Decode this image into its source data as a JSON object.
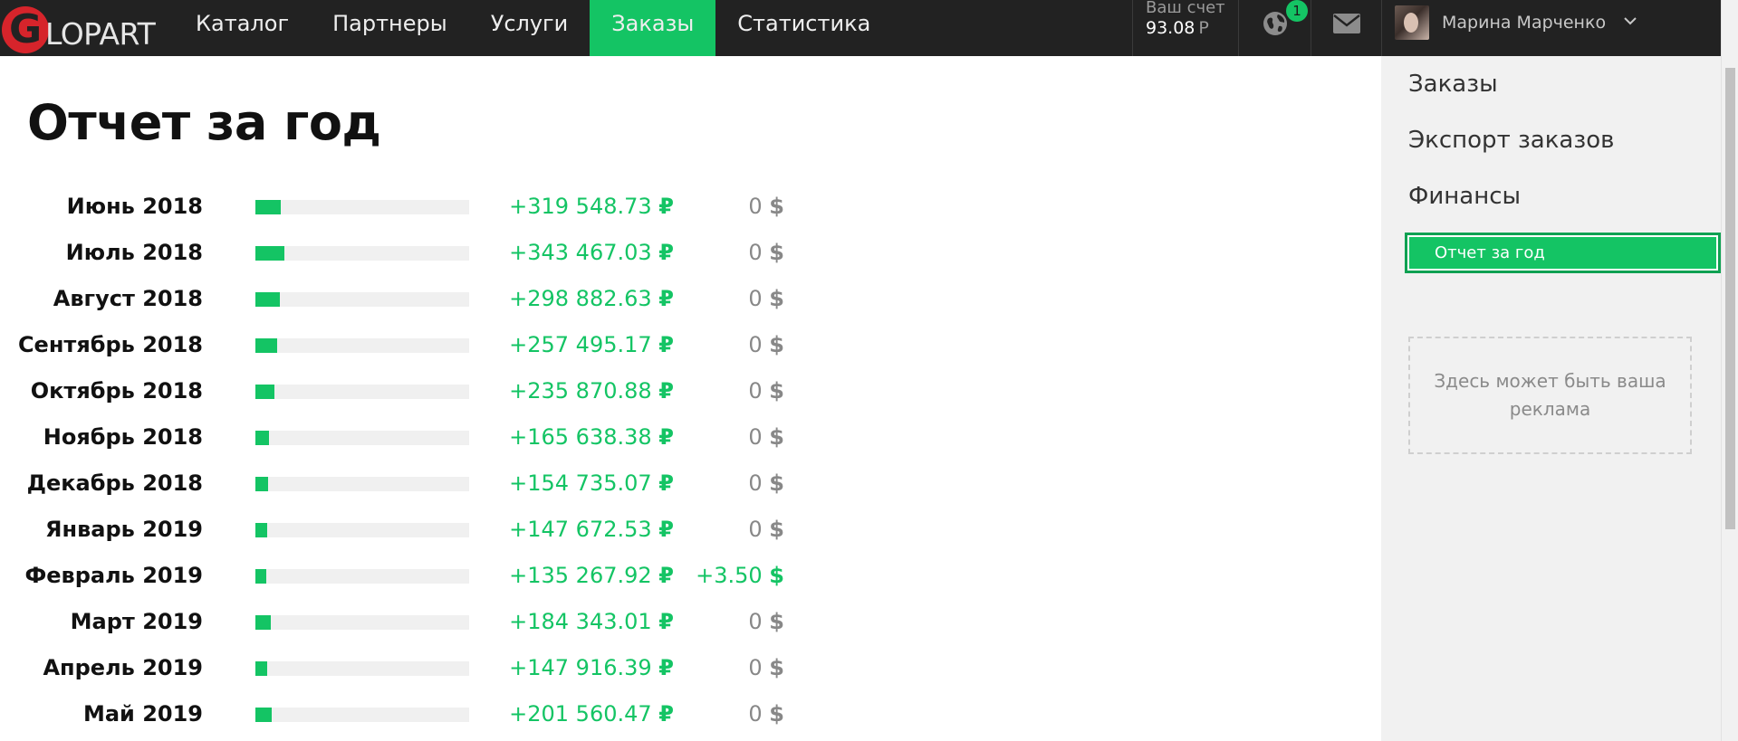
{
  "brand": {
    "logo_letter": "G",
    "logo_text": "LOPART"
  },
  "nav": {
    "items": [
      {
        "label": "Каталог",
        "active": false
      },
      {
        "label": "Партнеры",
        "active": false
      },
      {
        "label": "Услуги",
        "active": false
      },
      {
        "label": "Заказы",
        "active": true
      },
      {
        "label": "Статистика",
        "active": false
      }
    ]
  },
  "account": {
    "label": "Ваш счет",
    "value": "93.08",
    "currency": "Р"
  },
  "notifications": {
    "count": "1",
    "icon": "globe-icon"
  },
  "messages": {
    "icon": "envelope-icon"
  },
  "user": {
    "name": "Марина Марченко"
  },
  "sidebar": {
    "links": [
      "Заказы",
      "Экспорт заказов",
      "Финансы"
    ],
    "active_item": "Отчет за год",
    "ad_text": "Здесь может быть ваша реклама"
  },
  "report": {
    "title": "Отчет за год",
    "rub_symbol": "₽",
    "usd_symbol": "$",
    "rows": [
      {
        "month": "Июнь 2018",
        "rub": "+319 548.73",
        "usd": "0",
        "usd_positive": false,
        "share": 0.12
      },
      {
        "month": "Июль 2018",
        "rub": "+343 467.03",
        "usd": "0",
        "usd_positive": false,
        "share": 0.135
      },
      {
        "month": "Август 2018",
        "rub": "+298 882.63",
        "usd": "0",
        "usd_positive": false,
        "share": 0.115
      },
      {
        "month": "Сентябрь 2018",
        "rub": "+257 495.17",
        "usd": "0",
        "usd_positive": false,
        "share": 0.1
      },
      {
        "month": "Октябрь 2018",
        "rub": "+235 870.88",
        "usd": "0",
        "usd_positive": false,
        "share": 0.09
      },
      {
        "month": "Ноябрь 2018",
        "rub": "+165 638.38",
        "usd": "0",
        "usd_positive": false,
        "share": 0.065
      },
      {
        "month": "Декабрь 2018",
        "rub": "+154 735.07",
        "usd": "0",
        "usd_positive": false,
        "share": 0.06
      },
      {
        "month": "Январь 2019",
        "rub": "+147 672.53",
        "usd": "0",
        "usd_positive": false,
        "share": 0.057
      },
      {
        "month": "Февраль 2019",
        "rub": "+135 267.92",
        "usd": "+3.50",
        "usd_positive": true,
        "share": 0.052
      },
      {
        "month": "Март 2019",
        "rub": "+184 343.01",
        "usd": "0",
        "usd_positive": false,
        "share": 0.072
      },
      {
        "month": "Апрель 2019",
        "rub": "+147 916.39",
        "usd": "0",
        "usd_positive": false,
        "share": 0.057
      },
      {
        "month": "Май 2019",
        "rub": "+201 560.47",
        "usd": "0",
        "usd_positive": false,
        "share": 0.078
      }
    ]
  },
  "colors": {
    "accent": "#14c464",
    "topbar": "#222222",
    "sidebar": "#f1f1f1",
    "logo_red": "#d6242b"
  }
}
